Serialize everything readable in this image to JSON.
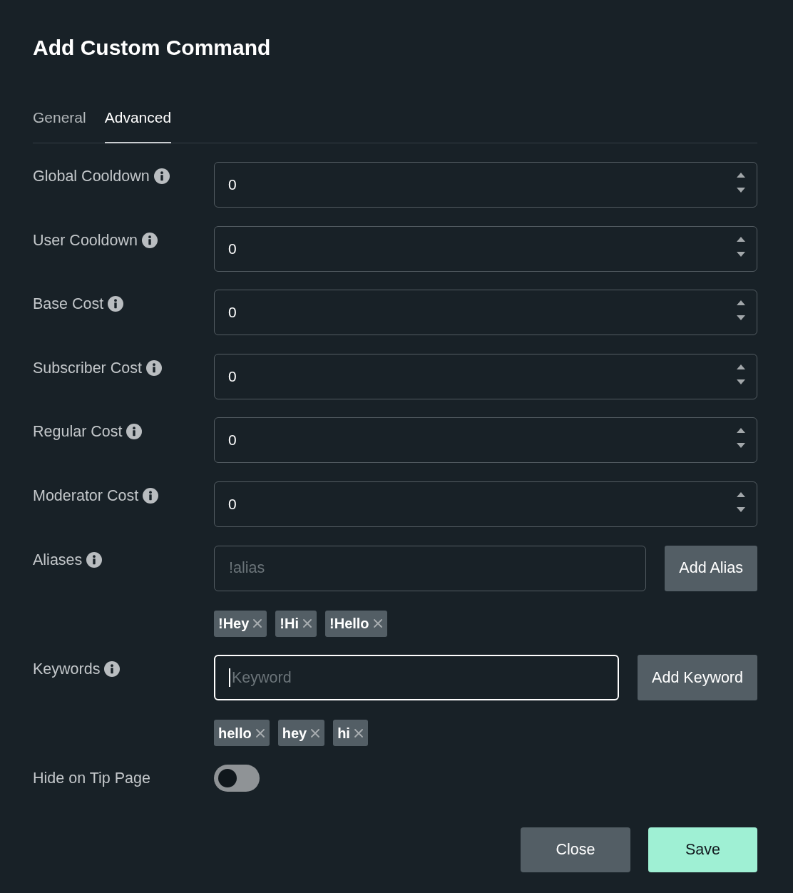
{
  "dialog": {
    "title": "Add Custom Command"
  },
  "tabs": [
    {
      "label": "General",
      "selected": false
    },
    {
      "label": "Advanced",
      "selected": true
    }
  ],
  "fields": [
    {
      "kind": "number",
      "label": "Global Cooldown",
      "info": true,
      "value": "0"
    },
    {
      "kind": "number",
      "label": "User Cooldown",
      "info": true,
      "value": "0"
    },
    {
      "kind": "number",
      "label": "Base Cost",
      "info": true,
      "value": "0"
    },
    {
      "kind": "number",
      "label": "Subscriber Cost",
      "info": true,
      "value": "0"
    },
    {
      "kind": "number",
      "label": "Regular Cost",
      "info": true,
      "value": "0"
    },
    {
      "kind": "number",
      "label": "Moderator Cost",
      "info": true,
      "value": "0"
    },
    {
      "kind": "tags",
      "label": "Aliases",
      "info": true,
      "placeholder": "!alias",
      "focused": false,
      "button": "Add Alias",
      "tags": [
        "!Hey",
        "!Hi",
        "!Hello"
      ]
    },
    {
      "kind": "tags",
      "label": "Keywords",
      "info": true,
      "placeholder": "Keyword",
      "focused": true,
      "button": "Add Keyword",
      "tags": [
        "hello",
        "hey",
        "hi"
      ]
    },
    {
      "kind": "toggle",
      "label": "Hide on Tip Page",
      "on": false
    }
  ],
  "buttons": [
    {
      "label": "Close",
      "kind": "secondary"
    },
    {
      "label": "Save",
      "kind": "primary"
    }
  ]
}
